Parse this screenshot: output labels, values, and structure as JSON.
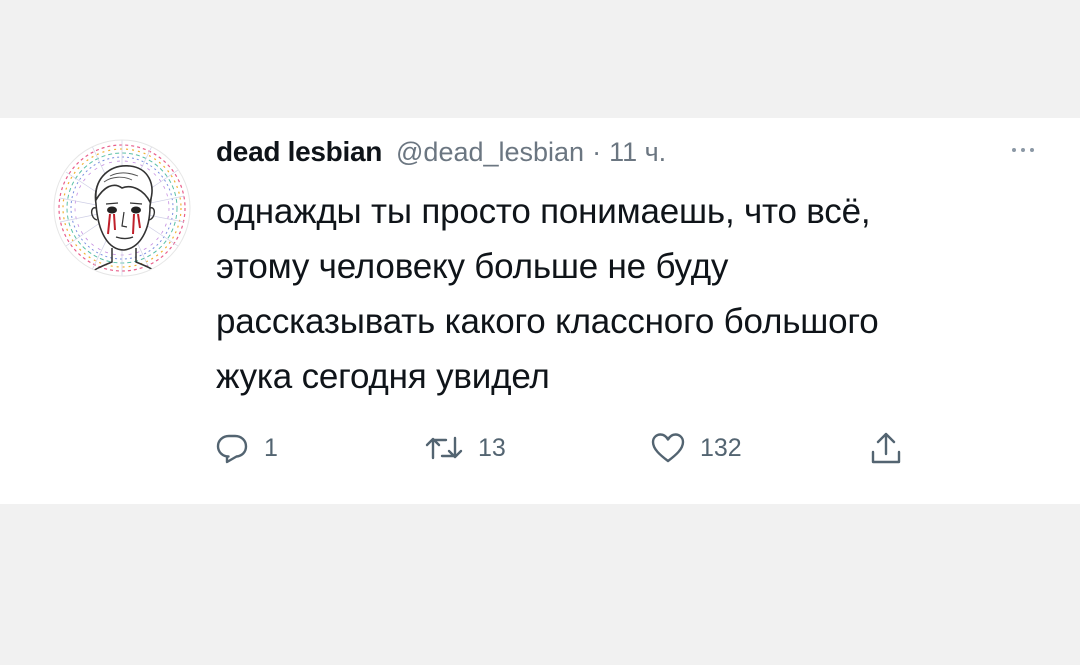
{
  "tweet": {
    "author": {
      "name": "dead lesbian",
      "handle": "@dead_lesbian",
      "separator": "·",
      "time": "11 ч."
    },
    "text_lines": [
      "однажды ты просто понимаешь, что всё,",
      "этому человеку больше не буду",
      "рассказывать какого классного большого",
      "жука сегодня увидел"
    ],
    "actions": {
      "reply_count": "1",
      "retweet_count": "13",
      "like_count": "132"
    },
    "icons": {
      "reply": "reply-icon",
      "retweet": "retweet-icon",
      "like": "heart-icon",
      "share": "share-icon",
      "more": "more-icon"
    }
  }
}
